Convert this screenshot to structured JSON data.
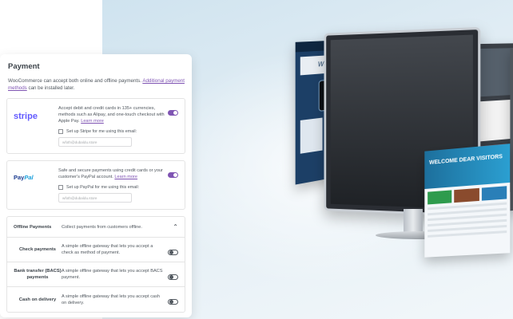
{
  "payment": {
    "title": "Payment",
    "intro": "WooCommerce can accept both online and offline payments.",
    "intro_link": "Additional payment methods",
    "intro_suffix": "can be installed later."
  },
  "stripe": {
    "logo": "stripe",
    "description": "Accept debit and credit cards in 135+ currencies, methods such as Alipay, and one-touch checkout with Apple Pay.",
    "learn_more": "Learn more",
    "checkbox_label": "Set up Stripe for me using this email:",
    "email": "wfoth@dubaldu.store",
    "enabled": true
  },
  "paypal": {
    "logo_pay": "Pay",
    "logo_pal": "Pal",
    "description": "Safe and secure payments using credit cards or your customer's PayPal account.",
    "learn_more": "Learn more",
    "checkbox_label": "Set up PayPal for me using this email:",
    "email": "wfoth@dubaldu.store",
    "enabled": true
  },
  "offline": {
    "title": "Offline Payments",
    "description": "Collect payments from customers offline.",
    "chevron": "chevron-up-icon",
    "methods": [
      {
        "name": "Check payments",
        "description": "A simple offline gateway that lets you accept a check as method of payment.",
        "enabled": false
      },
      {
        "name": "Bank transfer (BACS) payments",
        "description": "A simple offline gateway that lets you accept BACS payment.",
        "enabled": false
      },
      {
        "name": "Cash on delivery",
        "description": "A simple offline gateway that lets you accept cash on delivery.",
        "enabled": false
      }
    ]
  },
  "hero": {
    "site_title": "Welcome to Our Site",
    "banner_text": "WELCOME DEAR VISITORS"
  },
  "colors": {
    "accent": "#7f54b3",
    "stripe": "#635bff",
    "paypal_dark": "#1a3b8f",
    "paypal_light": "#1a9fdb"
  }
}
